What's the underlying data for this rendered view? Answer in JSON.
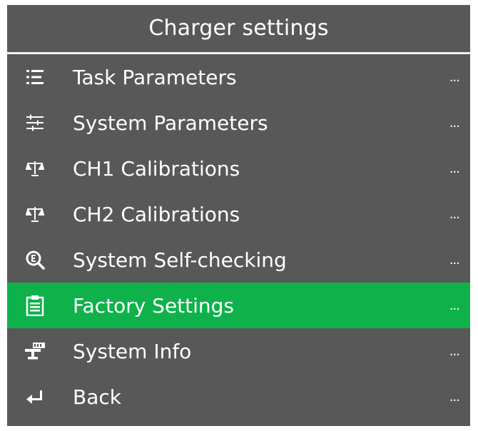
{
  "header": {
    "title": "Charger settings"
  },
  "menu": {
    "items": [
      {
        "label": "Task Parameters",
        "more": "...",
        "icon": "list-icon",
        "selected": false
      },
      {
        "label": "System Parameters",
        "more": "...",
        "icon": "sliders-icon",
        "selected": false
      },
      {
        "label": "CH1 Calibrations",
        "more": "...",
        "icon": "scale-icon",
        "selected": false
      },
      {
        "label": "CH2 Calibrations",
        "more": "...",
        "icon": "scale-icon",
        "selected": false
      },
      {
        "label": "System Self-checking",
        "more": "...",
        "icon": "magnifier-icon",
        "selected": false
      },
      {
        "label": "Factory Settings",
        "more": "...",
        "icon": "clipboard-icon",
        "selected": true
      },
      {
        "label": "System Info",
        "more": "...",
        "icon": "network-icon",
        "selected": false
      },
      {
        "label": "Back",
        "more": "...",
        "icon": "return-arrow-icon",
        "selected": false
      }
    ]
  },
  "colors": {
    "background": "#585858",
    "selected": "#0fb24a",
    "text": "#ffffff"
  }
}
